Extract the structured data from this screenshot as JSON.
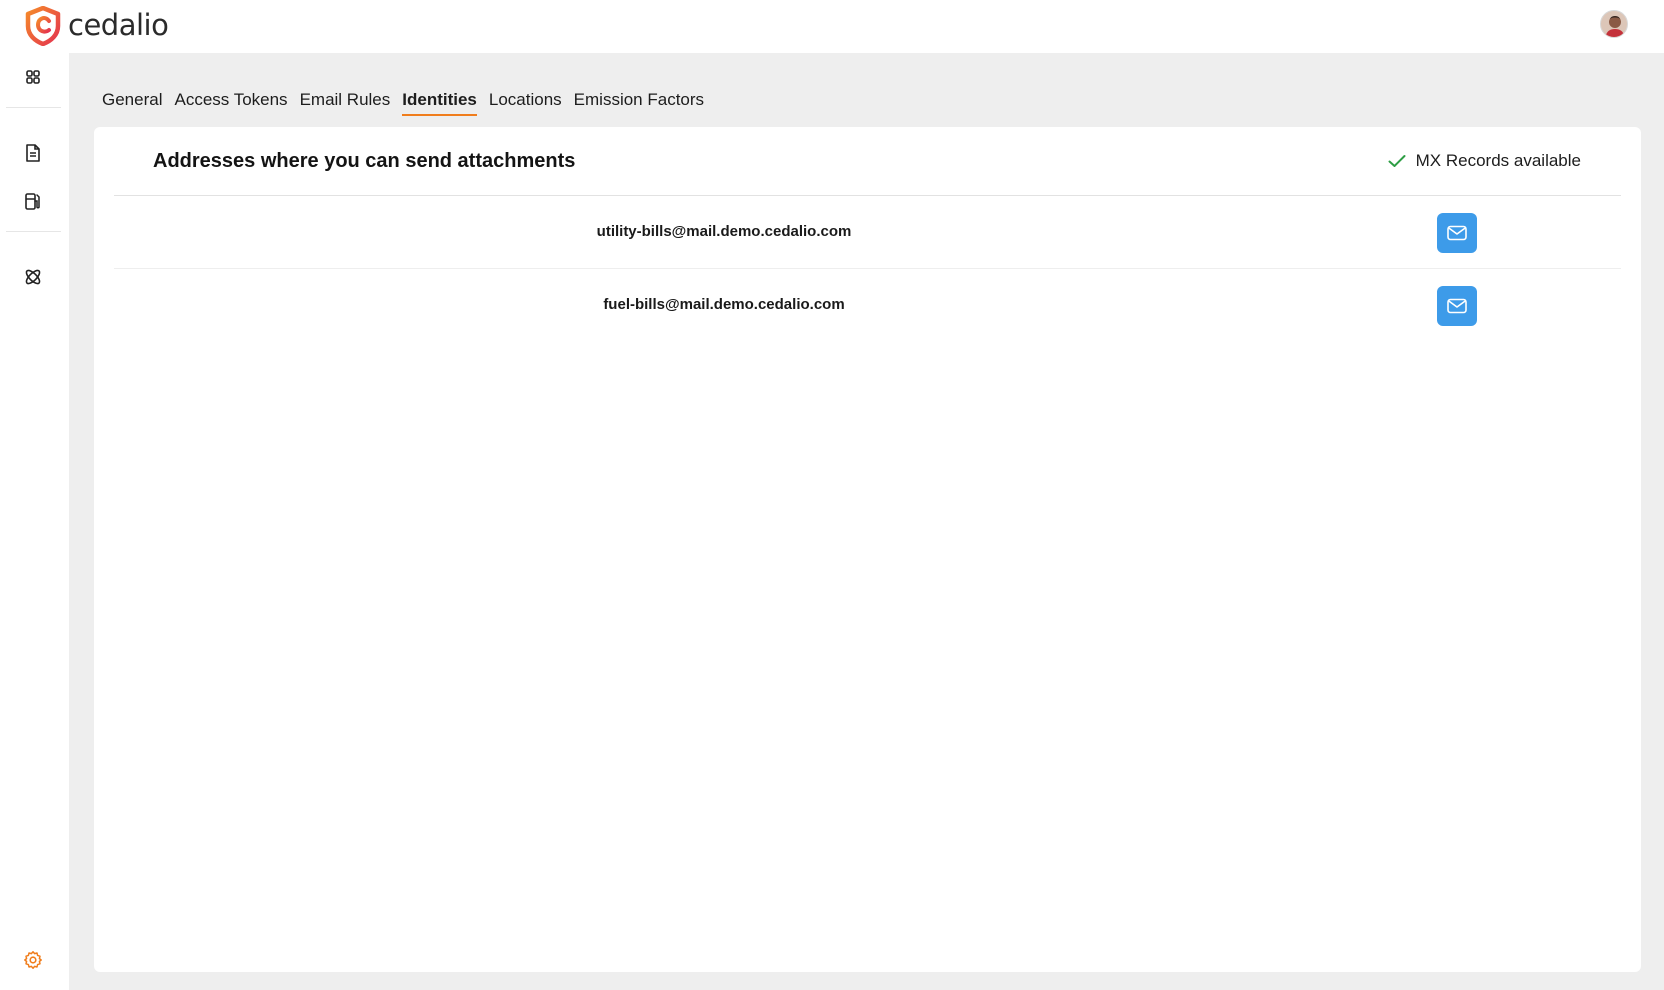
{
  "app": {
    "brand_name": "cedalio",
    "accent_color": "#f07d1c",
    "primary_button_color": "#3d9be9"
  },
  "header": {
    "avatar_icon": "user-avatar"
  },
  "sidebar": {
    "items": [
      {
        "name": "dashboard",
        "icon": "grid-icon"
      },
      {
        "name": "documents",
        "icon": "document-icon"
      },
      {
        "name": "fuel",
        "icon": "fuel-pump-icon"
      },
      {
        "name": "integrations",
        "icon": "atom-icon"
      },
      {
        "name": "settings",
        "icon": "gear-icon",
        "active": true
      }
    ]
  },
  "tabs": [
    {
      "label": "General",
      "active": false
    },
    {
      "label": "Access Tokens",
      "active": false
    },
    {
      "label": "Email Rules",
      "active": false
    },
    {
      "label": "Identities",
      "active": true
    },
    {
      "label": "Locations",
      "active": false
    },
    {
      "label": "Emission Factors",
      "active": false
    }
  ],
  "card": {
    "title": "Addresses where you can send attachments",
    "status": {
      "label": "MX Records available",
      "icon": "check-icon",
      "color": "#2e9e45"
    },
    "addresses": [
      {
        "email": "utility-bills@mail.demo.cedalio.com",
        "action_icon": "mail-icon"
      },
      {
        "email": "fuel-bills@mail.demo.cedalio.com",
        "action_icon": "mail-icon"
      }
    ]
  }
}
